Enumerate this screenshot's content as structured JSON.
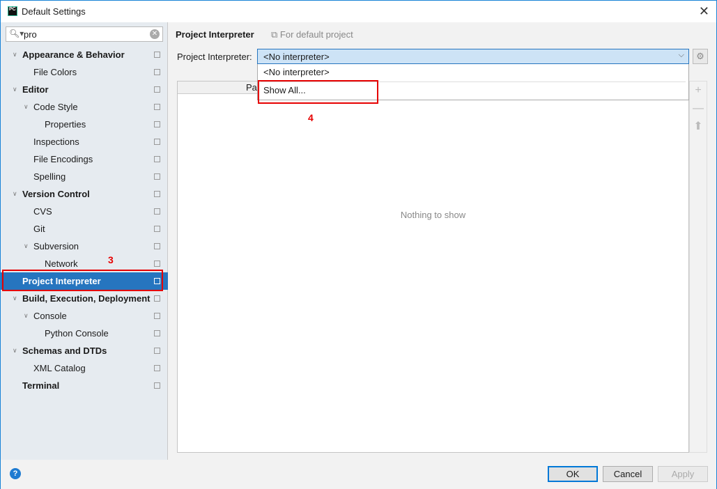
{
  "window": {
    "title": "Default Settings"
  },
  "search": {
    "value": "pro"
  },
  "tree": [
    {
      "label": "Appearance & Behavior",
      "level": 0,
      "bold": true,
      "arrow": true
    },
    {
      "label": "File Colors",
      "level": 1
    },
    {
      "label": "Editor",
      "level": 0,
      "bold": true,
      "arrow": true
    },
    {
      "label": "Code Style",
      "level": 1,
      "arrow": true
    },
    {
      "label": "Properties",
      "level": 2
    },
    {
      "label": "Inspections",
      "level": 1
    },
    {
      "label": "File Encodings",
      "level": 1
    },
    {
      "label": "Spelling",
      "level": 1
    },
    {
      "label": "Version Control",
      "level": 0,
      "bold": true,
      "arrow": true
    },
    {
      "label": "CVS",
      "level": 1
    },
    {
      "label": "Git",
      "level": 1
    },
    {
      "label": "Subversion",
      "level": 1,
      "arrow": true
    },
    {
      "label": "Network",
      "level": 2
    },
    {
      "label": "Project Interpreter",
      "level": 0,
      "bold": true,
      "selected": true
    },
    {
      "label": "Build, Execution, Deployment",
      "level": 0,
      "bold": true,
      "arrow": true
    },
    {
      "label": "Console",
      "level": 1,
      "arrow": true
    },
    {
      "label": "Python Console",
      "level": 2
    },
    {
      "label": "Schemas and DTDs",
      "level": 0,
      "bold": true,
      "arrow": true
    },
    {
      "label": "XML Catalog",
      "level": 1
    },
    {
      "label": "Terminal",
      "level": 0,
      "bold": true
    }
  ],
  "annotations": {
    "step3": "3",
    "step4": "4"
  },
  "main": {
    "heading": "Project Interpreter",
    "scope": "For default project",
    "interpreter_label": "Project Interpreter:",
    "interpreter_value": "<No interpreter>",
    "dropdown": [
      "<No interpreter>",
      "Show All..."
    ],
    "table_header": "Package",
    "empty": "Nothing to show"
  },
  "footer": {
    "ok": "OK",
    "cancel": "Cancel",
    "apply": "Apply",
    "help": "?"
  },
  "colors": {
    "selection": "#2675bf",
    "annotation": "#e60000"
  }
}
